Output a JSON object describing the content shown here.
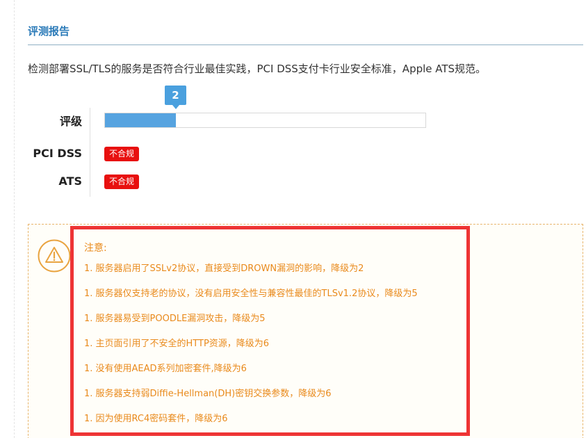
{
  "report": {
    "title": "评测报告",
    "description": "检测部署SSL/TLS的服务是否符合行业最佳实践，PCI DSS支付卡行业安全标准，Apple ATS规范。"
  },
  "rating": {
    "label": "评级",
    "grade": "2",
    "progress_fraction": 0.22
  },
  "compliance": [
    {
      "label": "PCI DSS",
      "status": "不合规"
    },
    {
      "label": "ATS",
      "status": "不合规"
    }
  ],
  "notice": {
    "icon": "warning-triangle-icon",
    "title": "注意:",
    "items": [
      "1. 服务器启用了SSLv2协议，直接受到DROWN漏洞的影响，降级为2",
      "1. 服务器仅支持老的协议，没有启用安全性与兼容性最佳的TLSv1.2协议，降级为5",
      "1. 服务器易受到POODLE漏洞攻击，降级为5",
      "1. 主页面引用了不安全的HTTP资源，降级为6",
      "1. 没有使用AEAD系列加密套件,降级为6",
      "1. 服务器支持弱Diffie-Hellman(DH)密钥交换参数，降级为6",
      "1. 因为使用RC4密码套件，降级为6"
    ]
  },
  "colors": {
    "title_blue": "#2a7ab8",
    "bar_blue": "#56a3e0",
    "badge_red": "#e8100f",
    "notice_orange": "#e98a1c",
    "highlight_red": "#ee3434"
  }
}
